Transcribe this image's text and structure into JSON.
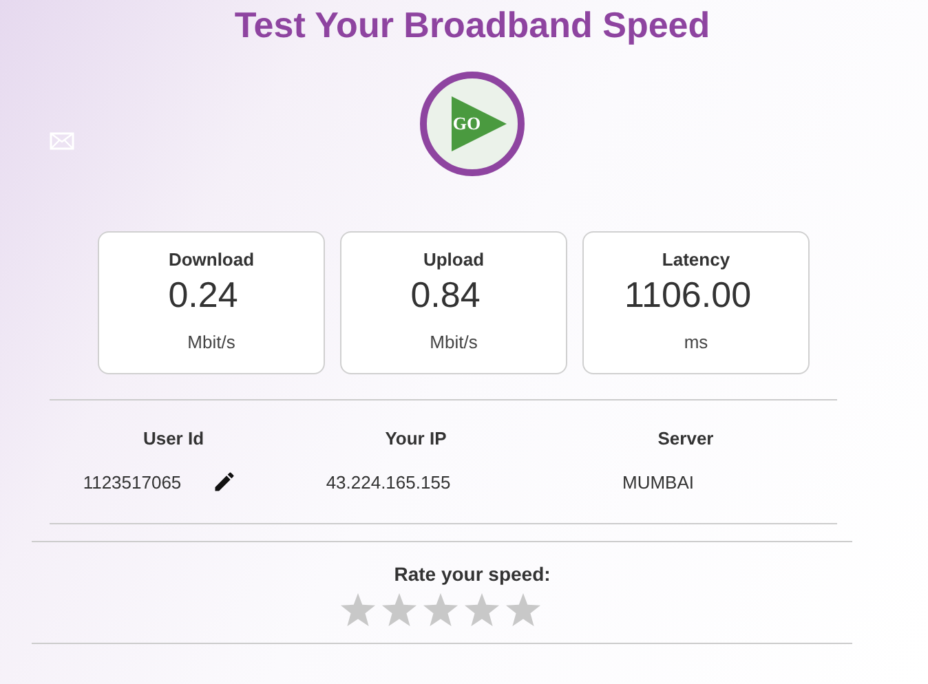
{
  "title": "Test Your Broadband Speed",
  "go_button": {
    "label": "GO"
  },
  "metrics": [
    {
      "label": "Download",
      "value": "0.24",
      "unit": "Mbit/s"
    },
    {
      "label": "Upload",
      "value": "0.84",
      "unit": "Mbit/s"
    },
    {
      "label": "Latency",
      "value": "1106.00",
      "unit": "ms"
    }
  ],
  "info": [
    {
      "label": "User Id",
      "value": "1123517065",
      "editable": true
    },
    {
      "label": "Your IP",
      "value": "43.224.165.155",
      "editable": false
    },
    {
      "label": "Server",
      "value": "MUMBAI",
      "editable": false
    }
  ],
  "rating": {
    "label": "Rate your speed:",
    "stars": 0
  }
}
